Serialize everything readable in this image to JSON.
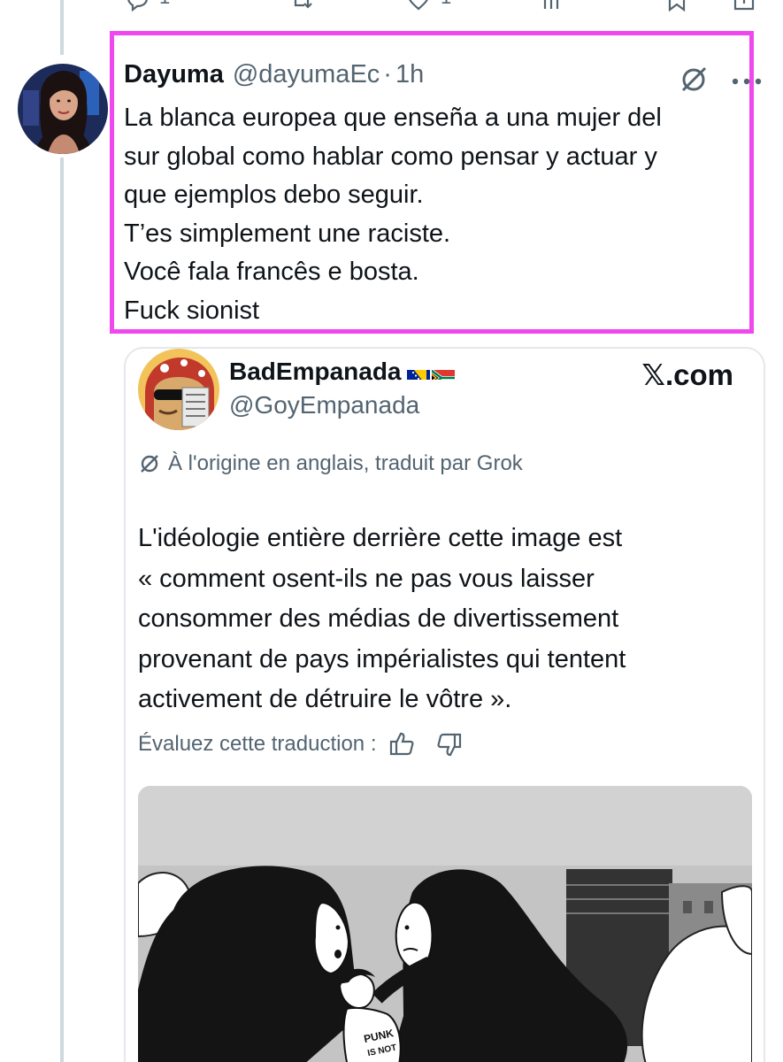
{
  "previous_tweet": {
    "actions": [
      "reply-icon",
      "repost-icon",
      "like-icon",
      "views-icon",
      "bookmark-icon",
      "share-icon"
    ],
    "reply_count": "1",
    "like_count": "1"
  },
  "reply": {
    "display_name": "Dayuma",
    "handle": "@dayumaEc",
    "separator": "·",
    "time": "1h",
    "lines": [
      "La blanca europea que enseña a una mujer del",
      "sur global como hablar como pensar y actuar y",
      "que ejemplos debo seguir.",
      "T’es simplement une raciste.",
      "Você fala francês e bosta.",
      "Fuck sionist"
    ]
  },
  "quote": {
    "display_name": "BadEmpanada",
    "flags": [
      "bosnia-flag-icon",
      "south-africa-flag-icon"
    ],
    "handle": "@GoyEmpanada",
    "brand": "𝕏.com",
    "translation_note": "À l'origine en anglais, traduit par Grok",
    "lines": [
      "L'idéologie entière derrière cette image est",
      "« comment osent-ils ne pas vous laisser",
      "consommer des médias de divertissement",
      "provenant de pays impérialistes qui tentent",
      "activement de détruire le vôtre »."
    ],
    "rate_label": "Évaluez cette traduction :",
    "media_text": "PUNK IS NOT"
  },
  "colors": {
    "highlight": "#ee48ee",
    "text": "#0f1419",
    "muted": "#536471",
    "border": "#e4e8eb"
  }
}
